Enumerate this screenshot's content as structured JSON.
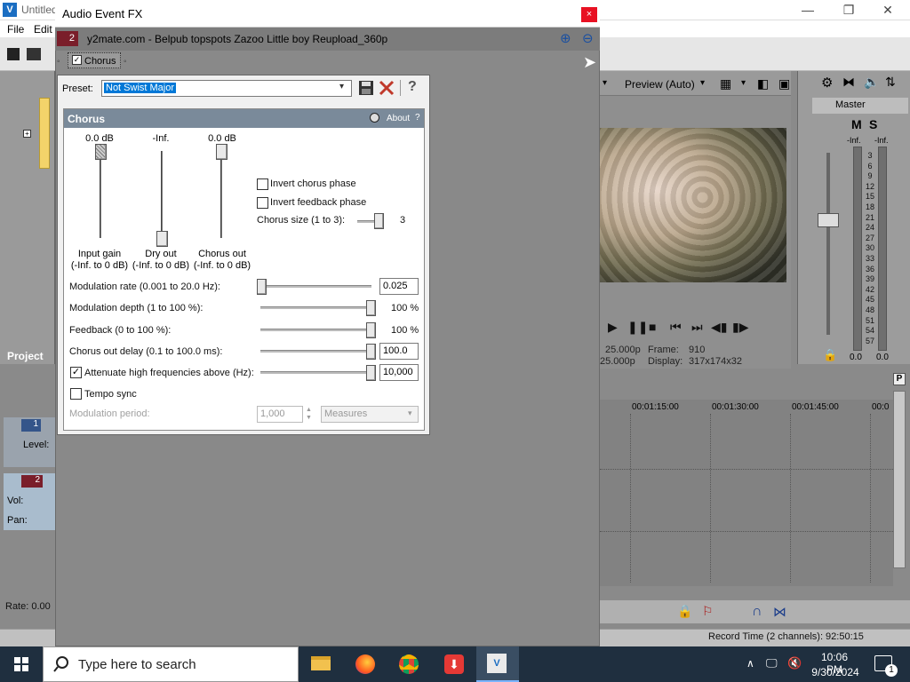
{
  "app": {
    "title": "Untitled",
    "menu": [
      "File",
      "Edit"
    ],
    "project_tab": "Project",
    "preview": {
      "mode": "Preview (Auto)",
      "project_label": "25.000p",
      "preview_label": "25.000p",
      "frame_label": "Frame:",
      "frame_value": "910",
      "display_label": "Display:",
      "display_value": "317x174x32"
    },
    "master": {
      "label": "Master",
      "m": "M",
      "s": "S",
      "left_top": "-Inf.",
      "right_top": "-Inf.",
      "left_bottom": "0.0",
      "right_bottom": "0.0",
      "scale": [
        "3",
        "6",
        "9",
        "12",
        "15",
        "18",
        "21",
        "24",
        "27",
        "30",
        "33",
        "36",
        "39",
        "42",
        "45",
        "48",
        "51",
        "54",
        "57"
      ]
    },
    "timeline": {
      "times": [
        "00:01:15:00",
        "00:01:30:00",
        "00:01:45:00",
        "00:0"
      ],
      "track1_number": "1",
      "track1_level": "Level:",
      "track2_number": "2",
      "track2_vol": "Vol:",
      "track2_pan": "Pan:",
      "rate": "Rate: 0.00",
      "record_time": "Record Time (2 channels): 92:50:15"
    }
  },
  "dialog": {
    "title": "Audio Event FX",
    "close_label": "×",
    "track_number": "2",
    "event_name": "y2mate.com - Belpub topspots Zazoo  Little boy Reupload_360p",
    "chain_tab": "Chorus",
    "preset_label": "Preset:",
    "preset_value": "Not Swist Major",
    "plugin": {
      "title": "Chorus",
      "about": "About",
      "about_q": "?",
      "faders": [
        {
          "value": "0.0 dB",
          "caption1": "Input gain",
          "caption2": "(-Inf. to 0 dB)",
          "level": 1.0
        },
        {
          "value": "-Inf.",
          "caption1": "Dry out",
          "caption2": "(-Inf. to 0 dB)",
          "level": 0.0
        },
        {
          "value": "0.0 dB",
          "caption1": "Chorus out",
          "caption2": "(-Inf. to 0 dB)",
          "level": 1.0
        }
      ],
      "invert_chorus_phase": {
        "label": "Invert chorus phase",
        "checked": false
      },
      "invert_feedback_phase": {
        "label": "Invert feedback phase",
        "checked": false
      },
      "chorus_size": {
        "label": "Chorus size (1 to 3):",
        "value": "3"
      },
      "modulation_rate": {
        "label": "Modulation rate (0.001 to 20.0 Hz):",
        "value": "0.025"
      },
      "modulation_depth": {
        "label": "Modulation depth (1 to 100 %):",
        "value": "100 %"
      },
      "feedback": {
        "label": "Feedback (0 to 100 %):",
        "value": "100 %"
      },
      "chorus_out_delay": {
        "label": "Chorus out delay (0.1 to 100.0 ms):",
        "value": "100.0"
      },
      "attenuate": {
        "label": "Attenuate high frequencies above (Hz):",
        "value": "10,000",
        "checked": true
      },
      "tempo_sync": {
        "label": "Tempo sync",
        "checked": false
      },
      "modulation_period": {
        "label": "Modulation period:",
        "value": "1,000",
        "unit": "Measures"
      }
    }
  },
  "taskbar": {
    "search_placeholder": "Type here to search",
    "time": "10:06 PM",
    "date": "9/30/2024",
    "notification_count": "1"
  }
}
